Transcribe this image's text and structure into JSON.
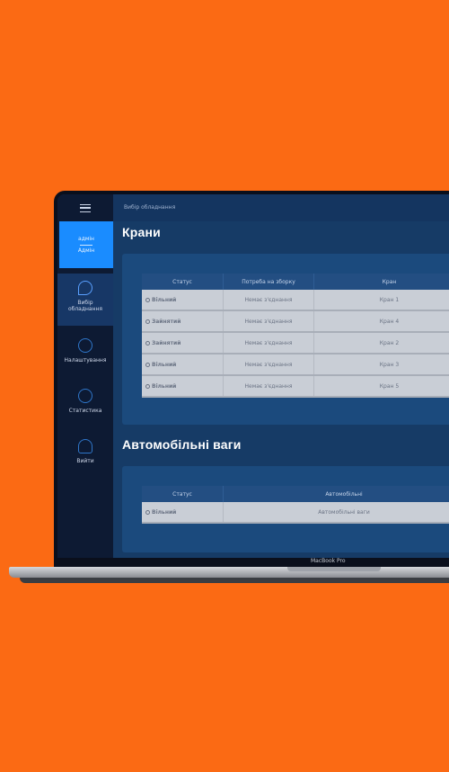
{
  "sidebar": {
    "user_line1": "адмін",
    "user_line2": "Адмін",
    "items": [
      {
        "label": "Вибір обладнання",
        "icon": "crane-hook-icon"
      },
      {
        "label": "Налаштування",
        "icon": "gear-icon"
      },
      {
        "label": "Статистика",
        "icon": "stats-icon"
      },
      {
        "label": "Вийти",
        "icon": "logout-person-icon"
      }
    ]
  },
  "header": {
    "breadcrumb": "Вибір обладнання"
  },
  "cranes": {
    "title": "Крани",
    "columns": [
      "Статус",
      "Потреба на зборку",
      "Кран"
    ],
    "rows": [
      {
        "status": "Вільний",
        "status_kind": "free",
        "need": "Немає з'єднання",
        "name": "Кран 1"
      },
      {
        "status": "Зайнятий",
        "status_kind": "busy",
        "need": "Немає з'єднання",
        "name": "Кран 4"
      },
      {
        "status": "Зайнятий",
        "status_kind": "busy",
        "need": "Немає з'єднання",
        "name": "Кран 2"
      },
      {
        "status": "Вільний",
        "status_kind": "free",
        "need": "Немає з'єднання",
        "name": "Кран 3"
      },
      {
        "status": "Вільний",
        "status_kind": "free",
        "need": "Немає з'єднання",
        "name": "Кран 5"
      }
    ]
  },
  "scales": {
    "title": "Автомобільні ваги",
    "columns": [
      "Статус",
      "Автомобільні"
    ],
    "rows": [
      {
        "status": "Вільний",
        "status_kind": "free",
        "name": "Автомобільні ваги"
      }
    ]
  },
  "laptop": {
    "model_label": "MacBook Pro"
  },
  "colors": {
    "background": "#fb6a14",
    "accent": "#1a8cff",
    "free": "#1bb94a",
    "busy": "#ff3b3b"
  }
}
